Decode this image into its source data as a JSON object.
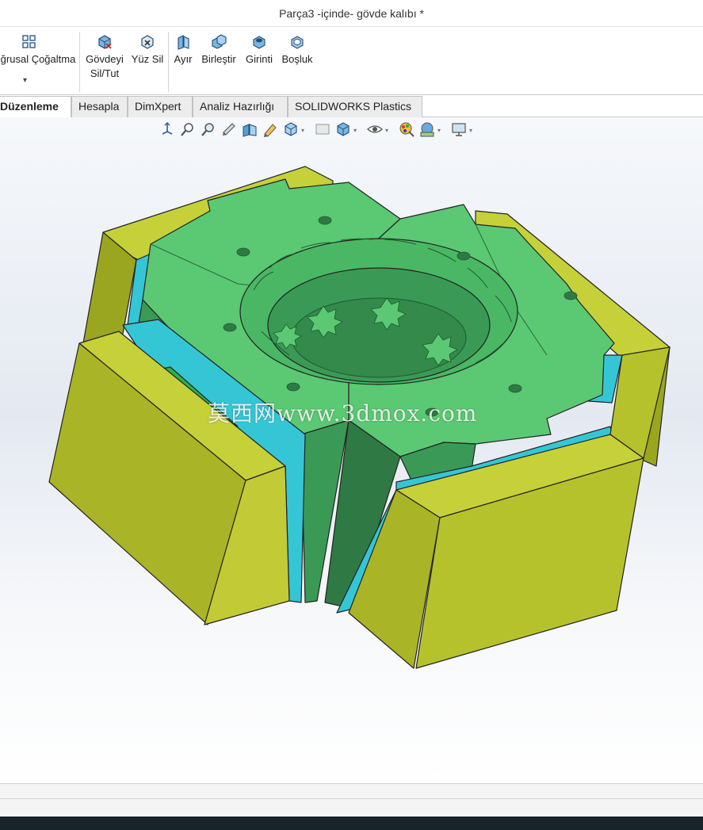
{
  "window": {
    "title": "Parça3 -içinde- gövde kalıbı *"
  },
  "ribbon": {
    "linear_pattern": {
      "label": "ğrusal Çoğaltma",
      "icon": "linear-pattern-icon"
    },
    "delete_keep_body": {
      "label_line1": "Gövdeyi",
      "label_line2": "Sil/Tut",
      "icon": "delete-body-icon"
    },
    "delete_face": {
      "label": "Yüz Sil",
      "icon": "delete-face-icon"
    },
    "split": {
      "label": "Ayır",
      "icon": "split-icon"
    },
    "combine": {
      "label": "Birleştir",
      "icon": "combine-icon"
    },
    "indent": {
      "label": "Girinti",
      "icon": "indent-icon"
    },
    "shell": {
      "label": "Boşluk",
      "icon": "shell-icon"
    }
  },
  "tabs": [
    {
      "label": "Düzenleme",
      "active": true
    },
    {
      "label": "Hesapla",
      "active": false
    },
    {
      "label": "DimXpert",
      "active": false
    },
    {
      "label": "Analiz Hazırlığı",
      "active": false
    },
    {
      "label": "SOLIDWORKS Plastics",
      "active": false
    }
  ],
  "heads_up_toolbar": [
    "view-orientation-icon",
    "zoom-to-fit-icon",
    "zoom-to-area-icon",
    "previous-view-icon",
    "section-view-icon",
    "dynamic-annotation-icon",
    "view-orientation-dropdown-icon",
    "display-style-icon",
    "hide-show-items-icon",
    "edit-appearance-icon",
    "apply-scene-icon",
    "view-settings-icon"
  ],
  "watermark": {
    "text": "莫西网www.3dmox.com"
  },
  "colors": {
    "mold_green": "#5bc873",
    "mold_dark_green": "#3a9a55",
    "base_yellow": "#b6c22c",
    "plate_cyan": "#35c6d6",
    "edge": "#222222",
    "taskbar": "#17242a"
  }
}
